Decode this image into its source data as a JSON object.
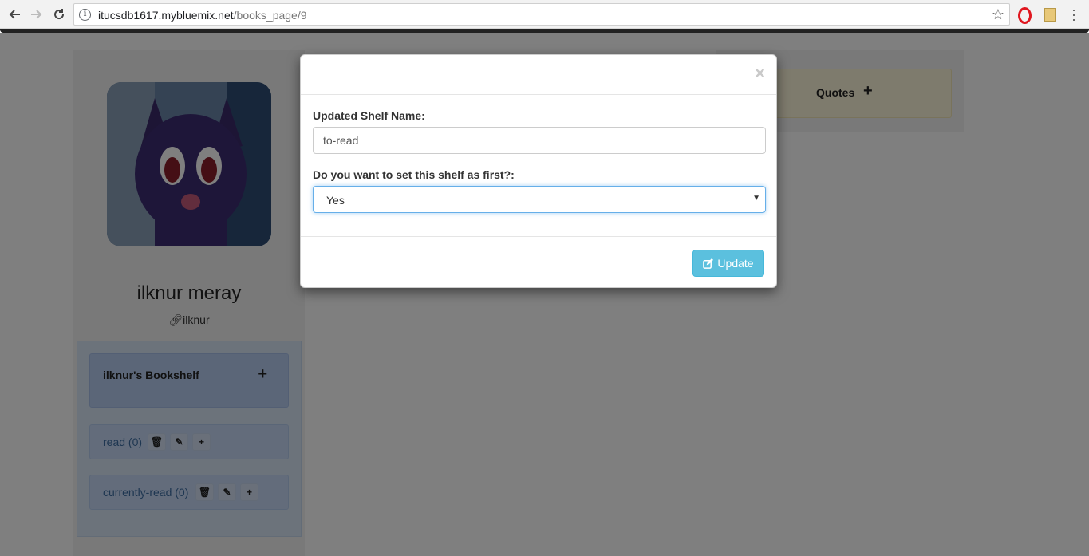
{
  "browser": {
    "url_host": "itucsdb1617.mybluemix.net",
    "url_path": "/books_page/9"
  },
  "profile": {
    "name": "ilknur meray",
    "username": "ilknur"
  },
  "bookshelf": {
    "title": "ilknur's Bookshelf",
    "shelves": [
      {
        "label": "read (0)"
      },
      {
        "label": "currently-read (0)"
      }
    ]
  },
  "quotes": {
    "label": "Quotes"
  },
  "modal": {
    "shelf_name_label": "Updated Shelf Name:",
    "shelf_name_value": "to-read",
    "first_label": "Do you want to set this shelf as first?:",
    "first_value": "Yes",
    "update_label": "Update",
    "close_symbol": "×"
  },
  "colors": {
    "update_button": "#5bc0de",
    "shelf_header": "#b7cdf0",
    "quotes_box": "#fdf6da"
  }
}
